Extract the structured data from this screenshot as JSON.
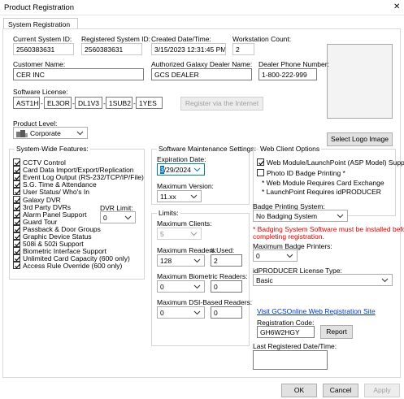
{
  "window": {
    "title": "Product Registration",
    "close_glyph": "✕"
  },
  "tabs": [
    "System Registration"
  ],
  "current_system_id": {
    "label": "Current System ID:",
    "value": "2560383631"
  },
  "registered_system_id": {
    "label": "Registered System ID:",
    "value": "2560383631"
  },
  "created": {
    "label": "Created Date/Time:",
    "value": "3/15/2023 12:31:45 PM"
  },
  "workstation_count": {
    "label": "Workstation Count:",
    "value": "2"
  },
  "customer_name": {
    "label": "Customer Name:",
    "value": "CER INC"
  },
  "dealer_name": {
    "label": "Authorized Galaxy Dealer Name:",
    "value": "GCS DEALER"
  },
  "dealer_phone": {
    "label": "Dealer Phone Number:",
    "value": "1-800-222-999"
  },
  "software_license": {
    "label": "Software License:",
    "parts": [
      "AST1H",
      "EL3OR",
      "DL1V3",
      "1SUB2",
      "1YES"
    ],
    "sep": "-"
  },
  "register_button": "Register via the Internet",
  "select_logo_button": "Select Logo Image",
  "product_level": {
    "label": "Product Level:",
    "value": "Corporate"
  },
  "features": {
    "title": "System-Wide Features:",
    "items": [
      {
        "label": "CCTV Control",
        "checked": true
      },
      {
        "label": "Card Data Import/Export/Replication",
        "checked": true
      },
      {
        "label": "Event Log Output (RS-232/TCP/IP/File)",
        "checked": true
      },
      {
        "label": "S.G. Time & Attendance",
        "checked": true
      },
      {
        "label": "User Status/ Who's In",
        "checked": true
      },
      {
        "label": "Galaxy DVR",
        "checked": true
      },
      {
        "label": "3rd Party DVRs",
        "checked": true
      },
      {
        "label": "Alarm Panel Support",
        "checked": true
      },
      {
        "label": "Guard Tour",
        "checked": true
      },
      {
        "label": "Passback & Door Groups",
        "checked": true
      },
      {
        "label": "Graphic Device Status",
        "checked": true
      },
      {
        "label": "508i & 502i Support",
        "checked": true
      },
      {
        "label": "Biometric Interface Support",
        "checked": true
      },
      {
        "label": "Unlimited Card Capacity (600 only)",
        "checked": true
      },
      {
        "label": "Access Rule Override (600 only)",
        "checked": true
      }
    ],
    "dvr_limit": {
      "label": "DVR Limit:",
      "value": "0"
    }
  },
  "maintenance": {
    "title": "Software Maintenance Settings:",
    "expiration": {
      "label": "Expiration Date:",
      "month_highlight": "3",
      "rest": "/29/2024"
    },
    "max_version": {
      "label": "Maximum Version:",
      "value": "11.xx"
    }
  },
  "limits": {
    "title": "Limits:",
    "max_clients": {
      "label": "Maximum Clients:",
      "value": "5"
    },
    "max_readers": {
      "label": "Maximum Readers:",
      "value": "128"
    },
    "used": {
      "label": "# Used:",
      "value": "2"
    },
    "max_biometric": {
      "label": "Maximum Biometric Readers:",
      "value": "0",
      "used": "0"
    },
    "max_dsi": {
      "label": "Maximum DSI-Based Readers:",
      "value": "0",
      "used": "0"
    }
  },
  "web_client": {
    "title": "Web Client Options",
    "web_module": {
      "label": "Web Module/LaunchPoint (ASP Model) Support",
      "checked": true
    },
    "photo_id": {
      "label": "Photo ID Badge Printing *",
      "checked": false
    },
    "notes": [
      "* Web Module Requires Card Exchange",
      "* LaunchPoint Requires idPRODUCER"
    ]
  },
  "badge_printing": {
    "label": "Badge Printing System:",
    "value": "No Badging System",
    "warning": [
      "* Badging System Software must be installed before",
      "completing registration."
    ]
  },
  "max_badge_printers": {
    "label": "Maximum Badge Printers:",
    "value": "0"
  },
  "idproducer": {
    "label": "idPRODUCER License Type:",
    "value": "Basic"
  },
  "gcs_link": "Visit GCSOnline Web Registration Site",
  "registration_code": {
    "label": "Registration Code:",
    "value": "GH6W2HGY"
  },
  "report_button": "Report",
  "last_registered": {
    "label": "Last Registered Date/Time:",
    "value": ""
  },
  "footer": {
    "ok": "OK",
    "cancel": "Cancel",
    "apply": "Apply"
  }
}
